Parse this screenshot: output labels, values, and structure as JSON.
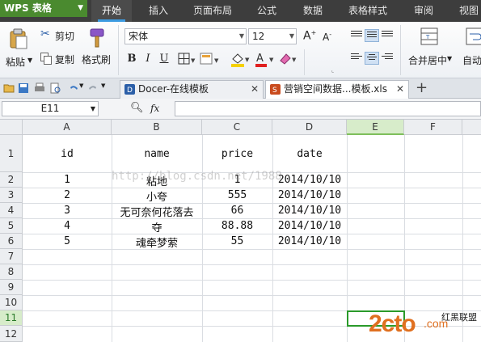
{
  "app": {
    "logo": "WPS 表格"
  },
  "menu_tabs": [
    {
      "label": "开始"
    },
    {
      "label": "插入"
    },
    {
      "label": "页面布局"
    },
    {
      "label": "公式"
    },
    {
      "label": "数据"
    },
    {
      "label": "表格样式"
    },
    {
      "label": "审阅"
    },
    {
      "label": "视图"
    }
  ],
  "ribbon": {
    "paste": "粘贴",
    "cut": "剪切",
    "copy": "复制",
    "format_painter": "格式刷",
    "font_name": "宋体",
    "font_size": "12",
    "bold": "B",
    "italic": "I",
    "underline": "U",
    "merge_center": "合并居中",
    "auto_wrap": "自动"
  },
  "doc_tabs": [
    {
      "label": "Docer-在线模板"
    },
    {
      "label": "营销空间数据...模板.xls"
    }
  ],
  "formula_bar": {
    "name_box": "E11",
    "fx": "fx",
    "value": ""
  },
  "columns": [
    "A",
    "B",
    "C",
    "D",
    "E",
    "F"
  ],
  "selected_column": "E",
  "rows": [
    "1",
    "2",
    "3",
    "4",
    "5",
    "6",
    "7",
    "8",
    "9",
    "10",
    "11",
    "12"
  ],
  "selected_row": "11",
  "sheet": {
    "header": [
      "id",
      "name",
      "price",
      "date"
    ],
    "data": [
      [
        "1",
        "粘地",
        "1",
        "2014/10/10"
      ],
      [
        "2",
        "小夸",
        "555",
        "2014/10/10"
      ],
      [
        "3",
        "无可奈何花落去",
        "66",
        "2014/10/10"
      ],
      [
        "4",
        "夺",
        "88.88",
        "2014/10/10"
      ],
      [
        "5",
        "魂牵梦萦",
        "55",
        "2014/10/10"
      ]
    ]
  },
  "watermark": "http://blog.csdn.net/1988",
  "brand": {
    "left": "2cto",
    "right": ".com",
    "cn": "红黑联盟"
  },
  "colors": {
    "menubar": "#3d3d3d",
    "logo": "#4a8a2f",
    "accent": "#3c9ae0",
    "selected_header": "#d7ecca"
  }
}
